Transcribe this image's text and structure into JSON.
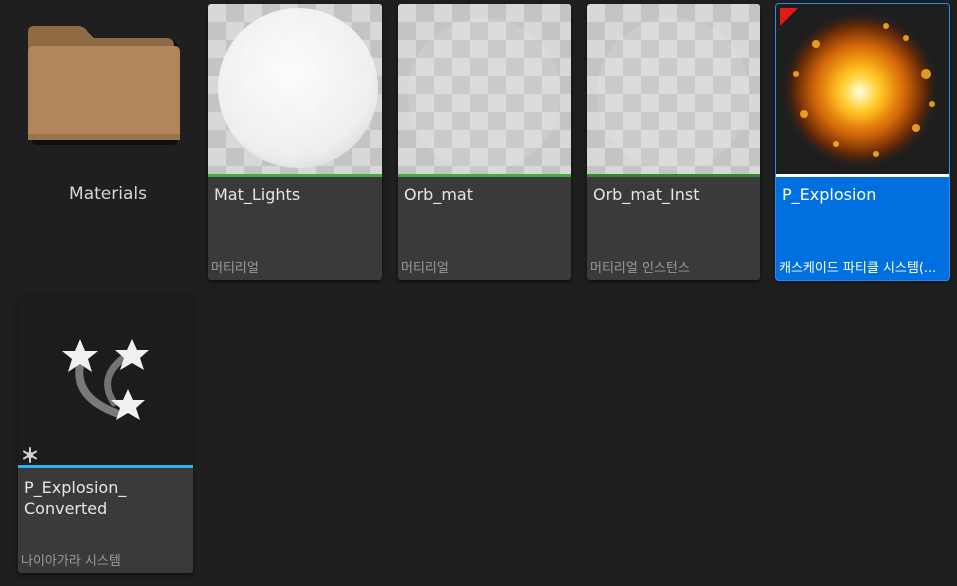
{
  "assets": [
    {
      "id": "materials",
      "name": "Materials",
      "kind": "folder"
    },
    {
      "id": "mat-lights",
      "name": "Mat_Lights",
      "type": "머티리얼",
      "bar_color": "#3fae3f"
    },
    {
      "id": "orb-mat",
      "name": "Orb_mat",
      "type": "머티리얼",
      "bar_color": "#3fae3f"
    },
    {
      "id": "orb-mat-inst",
      "name": "Orb_mat_Inst",
      "type": "머티리얼 인스턴스",
      "bar_color": "#2e8a2e"
    },
    {
      "id": "p-explosion",
      "name": "P_Explosion",
      "type": "캐스케이드 파티클 시스템(...",
      "bar_color": "#ffffff",
      "selected": true
    },
    {
      "id": "p-explosion-converted",
      "name": "P_Explosion_\nConverted",
      "type": "나이아가라 시스템",
      "bar_color": "#29b6f0"
    }
  ],
  "colors": {
    "background": "#1f1f1f",
    "tile": "#3a3a3a",
    "selection": "#0070e0",
    "folder": "#b0865a",
    "dirty_flag": "#e01a1a"
  }
}
